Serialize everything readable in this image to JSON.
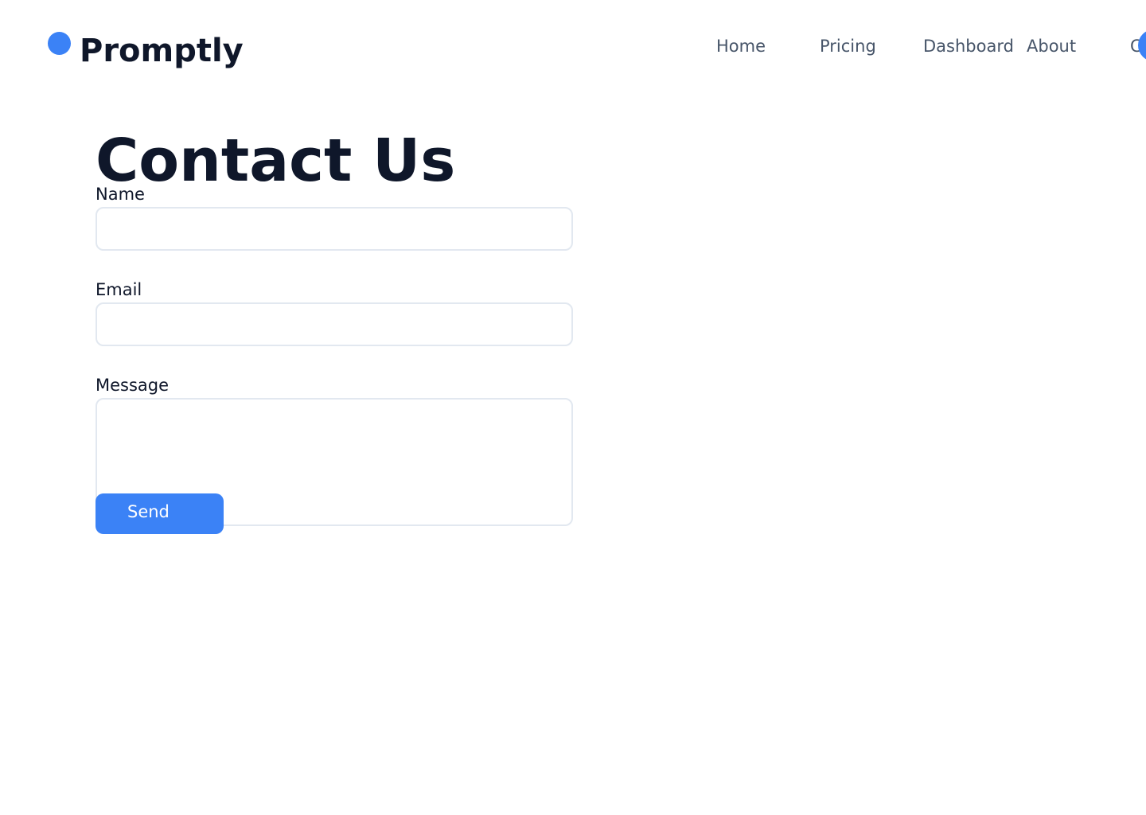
{
  "header": {
    "brand": "Promptly",
    "nav": [
      {
        "label": "Home"
      },
      {
        "label": "Pricing"
      },
      {
        "label": "Dashboard"
      },
      {
        "label": "About"
      },
      {
        "label": "C"
      }
    ]
  },
  "main": {
    "title": "Contact Us",
    "form": {
      "name_label": "Name",
      "name_value": "",
      "email_label": "Email",
      "email_value": "",
      "message_label": "Message",
      "message_value": "",
      "send_label": "Send"
    }
  },
  "colors": {
    "accent": "#3b82f6",
    "heading": "#0f172a",
    "nav_text": "#475569",
    "field_border": "#e2e8f0"
  }
}
